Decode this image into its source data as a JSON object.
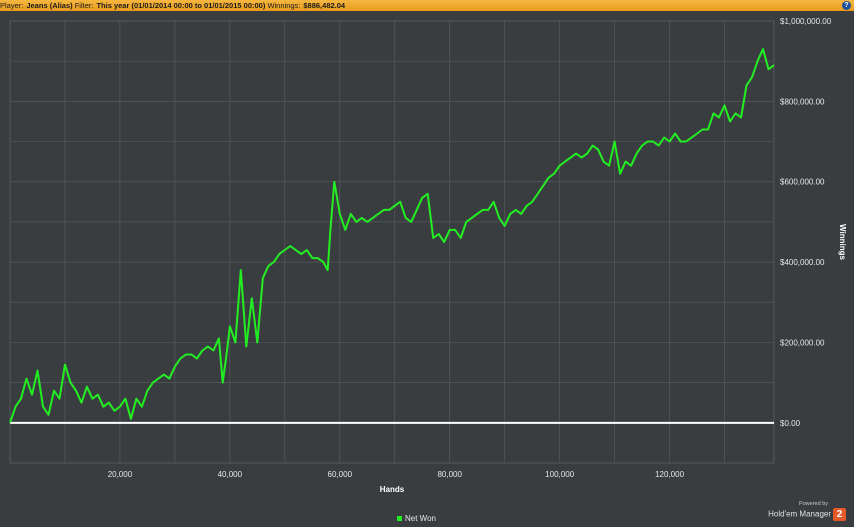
{
  "header": {
    "player_label": "Player:",
    "player_value": "Jeans (Alias)",
    "filter_label": "Filter:",
    "filter_value": "This year (01/01/2014 00:00 to 01/01/2015 00:00)",
    "winnings_label": "Winnings:",
    "winnings_value": "$886,482.04",
    "help_icon": "question-icon",
    "help_glyph": "?"
  },
  "footer": {
    "powered_by": "Powered by",
    "brand": "Hold'em Manager",
    "brand_badge": "2"
  },
  "colors": {
    "background": "#3a3d40",
    "grid": "#55595c",
    "series": "#22ee22",
    "zero_line": "#ffffff",
    "header_bar": "#f0a830"
  },
  "chart_data": {
    "type": "line",
    "xlabel": "Hands",
    "ylabel": "Winnings",
    "xlim": [
      0,
      139000
    ],
    "ylim": [
      -100000,
      1000000
    ],
    "x_ticks": [
      20000,
      40000,
      60000,
      80000,
      100000,
      120000
    ],
    "x_tick_labels": [
      "20,000",
      "40,000",
      "60,000",
      "80,000",
      "100,000",
      "120,000"
    ],
    "y_ticks": [
      0,
      200000,
      400000,
      600000,
      800000,
      1000000
    ],
    "y_tick_labels": [
      "$0.00",
      "$200,000.00",
      "$400,000.00",
      "$600,000.00",
      "$800,000.00",
      "$1,000,000.00"
    ],
    "grid": true,
    "legend_position": "bottom",
    "zero_line": true,
    "series": [
      {
        "name": "Net Won",
        "x": [
          0,
          1000,
          2000,
          3000,
          4000,
          5000,
          6000,
          7000,
          8000,
          9000,
          10000,
          11000,
          12000,
          13000,
          14000,
          15000,
          16000,
          17000,
          18000,
          19000,
          20000,
          21000,
          22000,
          23000,
          24000,
          25000,
          26000,
          27000,
          28000,
          29000,
          30000,
          31000,
          32000,
          33000,
          34000,
          35000,
          36000,
          37000,
          38000,
          38700,
          39300,
          40000,
          41000,
          42000,
          43000,
          44000,
          45000,
          46000,
          47000,
          48000,
          49000,
          50000,
          51000,
          52000,
          53000,
          54000,
          55000,
          56000,
          57000,
          57800,
          58300,
          59000,
          60000,
          61000,
          62000,
          63000,
          64000,
          65000,
          66000,
          67000,
          68000,
          69000,
          70000,
          71000,
          72000,
          73000,
          74000,
          75000,
          76000,
          77000,
          78000,
          79000,
          80000,
          81000,
          82000,
          83000,
          84000,
          85000,
          86000,
          87000,
          88000,
          89000,
          90000,
          91000,
          92000,
          93000,
          94000,
          95000,
          96000,
          97000,
          98000,
          99000,
          100000,
          101000,
          102000,
          103000,
          104000,
          105000,
          106000,
          107000,
          108000,
          109000,
          110000,
          111000,
          112000,
          113000,
          114000,
          115000,
          116000,
          117000,
          118000,
          119000,
          120000,
          121000,
          122000,
          123000,
          124000,
          125000,
          126000,
          127000,
          128000,
          129000,
          130000,
          131000,
          132000,
          133000,
          134000,
          135000,
          136000,
          137000,
          138000,
          139000
        ],
        "y": [
          0,
          40000,
          60000,
          110000,
          70000,
          130000,
          40000,
          20000,
          80000,
          60000,
          145000,
          100000,
          80000,
          50000,
          90000,
          60000,
          70000,
          40000,
          50000,
          30000,
          40000,
          60000,
          10000,
          60000,
          40000,
          80000,
          100000,
          110000,
          120000,
          110000,
          140000,
          160000,
          170000,
          170000,
          160000,
          180000,
          190000,
          180000,
          210000,
          100000,
          160000,
          240000,
          200000,
          380000,
          190000,
          310000,
          200000,
          360000,
          390000,
          400000,
          420000,
          430000,
          440000,
          430000,
          420000,
          430000,
          410000,
          410000,
          400000,
          380000,
          480000,
          600000,
          520000,
          480000,
          520000,
          500000,
          510000,
          500000,
          510000,
          520000,
          530000,
          530000,
          540000,
          550000,
          510000,
          500000,
          530000,
          560000,
          570000,
          460000,
          470000,
          450000,
          480000,
          480000,
          460000,
          500000,
          510000,
          520000,
          530000,
          530000,
          550000,
          510000,
          490000,
          520000,
          530000,
          520000,
          540000,
          550000,
          570000,
          590000,
          610000,
          620000,
          640000,
          650000,
          660000,
          670000,
          660000,
          670000,
          690000,
          680000,
          650000,
          640000,
          700000,
          620000,
          650000,
          640000,
          670000,
          690000,
          700000,
          700000,
          690000,
          710000,
          700000,
          720000,
          700000,
          700000,
          710000,
          720000,
          730000,
          730000,
          770000,
          760000,
          790000,
          750000,
          770000,
          760000,
          840000,
          860000,
          900000,
          930000,
          880000,
          890000
        ]
      }
    ]
  }
}
